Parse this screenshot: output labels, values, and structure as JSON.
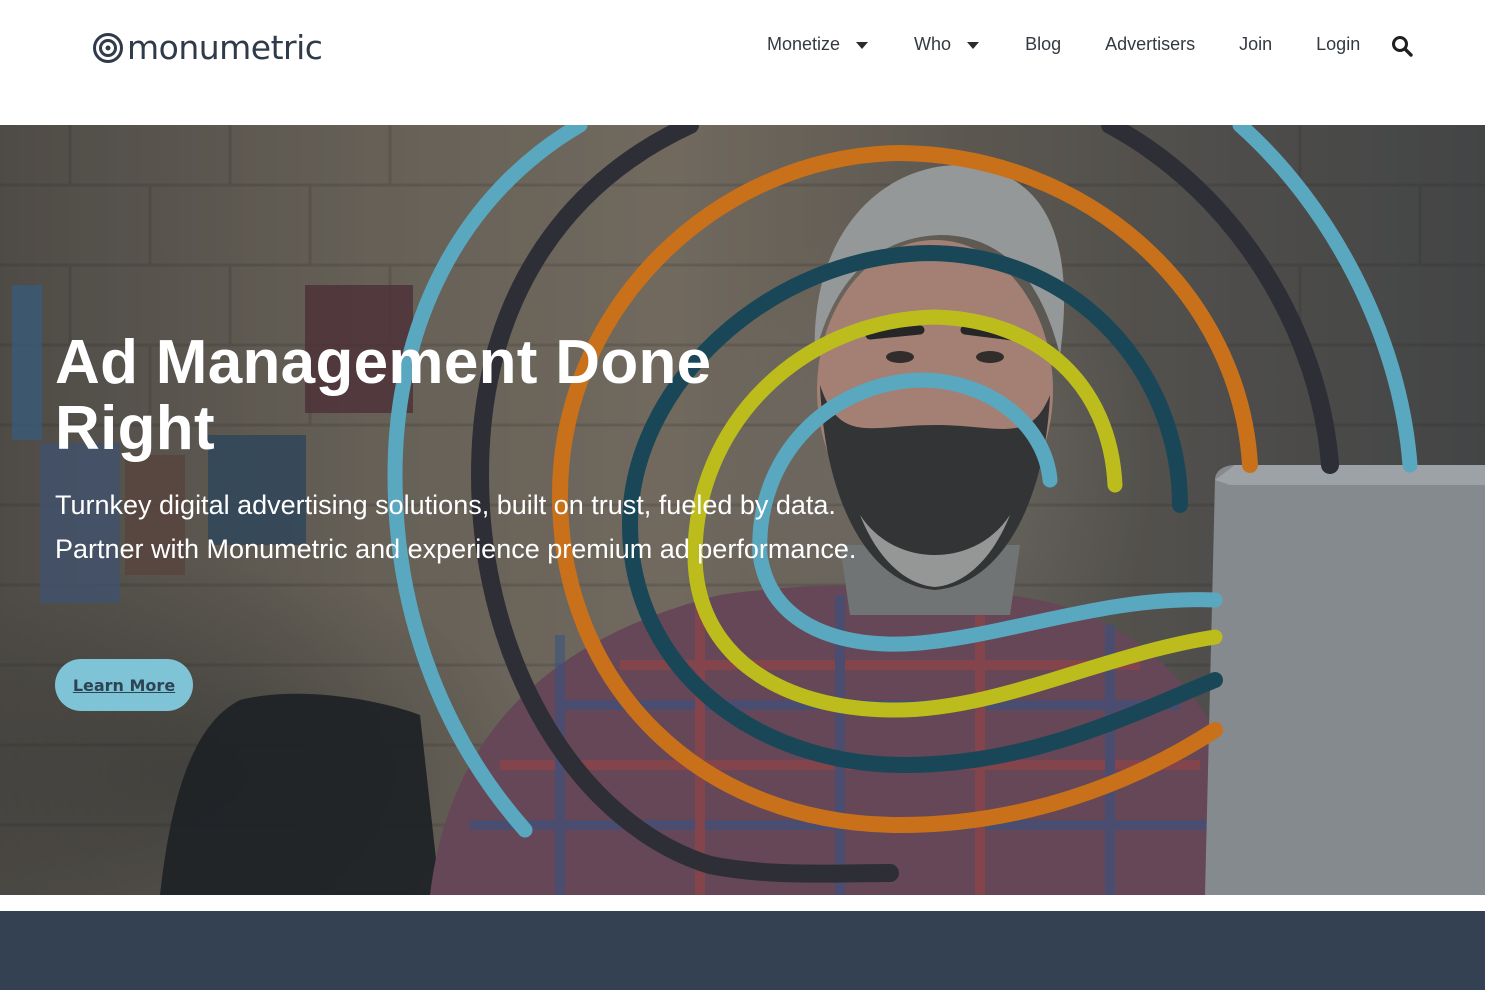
{
  "brand": {
    "name": "monumetric"
  },
  "nav": {
    "items": [
      {
        "label": "Monetize",
        "has_dropdown": true
      },
      {
        "label": "Who",
        "has_dropdown": true
      },
      {
        "label": "Blog",
        "has_dropdown": false
      },
      {
        "label": "Advertisers",
        "has_dropdown": false
      },
      {
        "label": "Join",
        "has_dropdown": false
      },
      {
        "label": "Login",
        "has_dropdown": false
      }
    ],
    "search_icon": "search-icon"
  },
  "hero": {
    "title": "Ad Management Done Right",
    "subtitle": "Turnkey digital advertising solutions, built on trust, fueled by data. Partner with Monumetric and experience premium ad performance.",
    "cta_label": "Learn More"
  },
  "colors": {
    "brand_dark": "#2f3b4a",
    "spiral_teal_light": "#5aa8bf",
    "spiral_charcoal": "#2e2f36",
    "spiral_orange": "#c8711a",
    "spiral_dark_teal": "#1a4757",
    "spiral_lime": "#bcbd1c",
    "cta_background": "#7fc3d6",
    "footer_band": "#334152"
  }
}
